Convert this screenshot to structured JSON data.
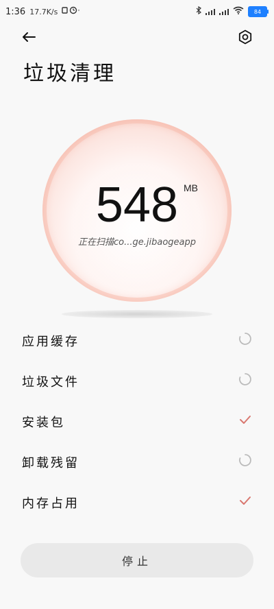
{
  "status_bar": {
    "time": "1:36",
    "network_speed": "17.7K/s",
    "battery": "84"
  },
  "header": {
    "title": "垃圾清理"
  },
  "gauge": {
    "value": "548",
    "unit": "MB",
    "status": "正在扫描co...ge.jibaogeapp"
  },
  "list": {
    "items": [
      {
        "label": "应用缓存",
        "state": "loading-icon"
      },
      {
        "label": "垃圾文件",
        "state": "loading-icon"
      },
      {
        "label": "安装包",
        "state": "check-icon"
      },
      {
        "label": "卸载残留",
        "state": "loading-icon"
      },
      {
        "label": "内存占用",
        "state": "check-icon"
      }
    ]
  },
  "actions": {
    "stop_label": "停止"
  },
  "colors": {
    "accent": "#e8837a",
    "check": "#d9776f"
  }
}
